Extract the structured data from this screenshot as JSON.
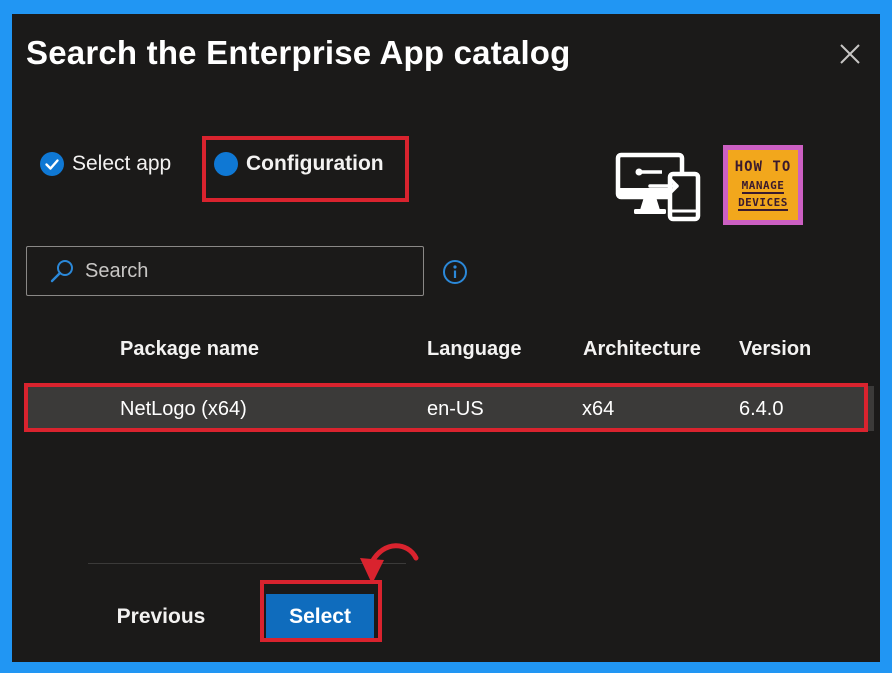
{
  "dialog": {
    "title": "Search the Enterprise App catalog",
    "close_icon": "close-icon"
  },
  "steps": [
    {
      "label": "Select app",
      "state": "completed",
      "icon": "checkmark-circle-icon"
    },
    {
      "label": "Configuration",
      "state": "current",
      "icon": "filled-circle-icon"
    }
  ],
  "branding": {
    "device_icon": "device-management-icon",
    "logo": {
      "line1": "HOW TO",
      "line2": "MANAGE",
      "line3": "DEVICES"
    }
  },
  "search": {
    "placeholder": "Search",
    "value": "",
    "icon": "search-icon",
    "info_icon": "info-icon"
  },
  "table": {
    "columns": [
      "Package name",
      "Language",
      "Architecture",
      "Version"
    ],
    "rows": [
      {
        "package_name": "NetLogo (x64)",
        "language": "en-US",
        "architecture": "x64",
        "version": "6.4.0",
        "selected": true
      }
    ]
  },
  "footer": {
    "previous_label": "Previous",
    "select_label": "Select"
  },
  "colors": {
    "accent": "#0f78d4",
    "highlight": "#d9232e",
    "background": "#1b1a19",
    "frame": "#2196f3"
  }
}
